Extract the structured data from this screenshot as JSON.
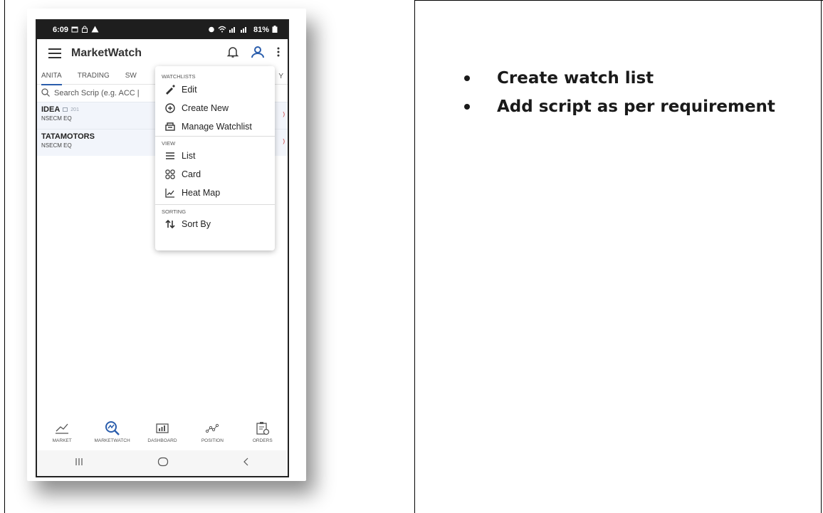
{
  "phone": {
    "status": {
      "time": "6:09",
      "battery": "81%"
    },
    "app_title": "MarketWatch",
    "tabs": [
      "ANITA",
      "TRADING",
      "SW"
    ],
    "tab_right_partial": "Y",
    "search_placeholder": "Search Scrip (e.g. ACC |",
    "rows": [
      {
        "symbol": "IDEA",
        "badge": "201",
        "exchange": "NSECM EQ",
        "edge": ")"
      },
      {
        "symbol": "TATAMOTORS",
        "exchange": "NSECM EQ",
        "edge": ")"
      }
    ],
    "menu": {
      "watchlists_title": "WATCHLISTS",
      "edit": "Edit",
      "create_new": "Create New",
      "manage": "Manage Watchlist",
      "view_title": "VIEW",
      "list": "List",
      "card": "Card",
      "heat_map": "Heat Map",
      "sorting_title": "SORTING",
      "sort_by": "Sort By"
    },
    "bottom_nav": [
      "MARKET",
      "MARKETWATCH",
      "DASHBOARD",
      "POSITION",
      "ORDERS"
    ],
    "accent_color": "#2a5dac"
  },
  "notes": {
    "bullets": [
      "Create watch list",
      "Add script as per requirement"
    ]
  }
}
